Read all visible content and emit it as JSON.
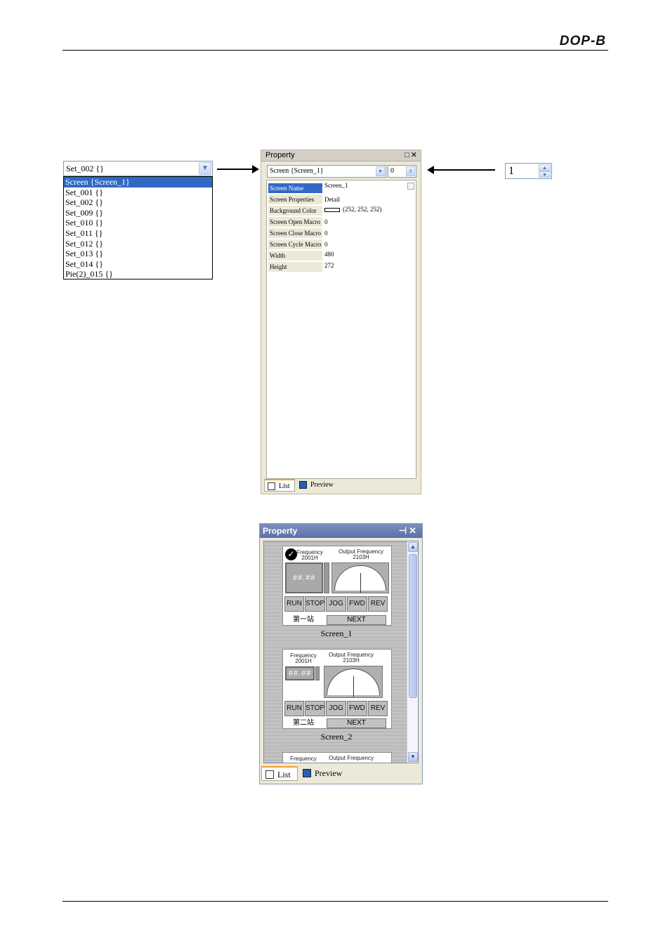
{
  "page": {
    "logo": "DOP-B"
  },
  "combo": {
    "value": "Set_002 {}",
    "options": [
      "Screen {Screen_1}",
      "Set_001 {}",
      "Set_002 {}",
      "Set_009 {}",
      "Set_010 {}",
      "Set_011 {}",
      "Set_012 {}",
      "Set_013 {}",
      "Set_014 {}",
      "Pie(2)_015 {}"
    ],
    "selected_index": 0
  },
  "spin": {
    "value": "1"
  },
  "panel1": {
    "title": "Property",
    "screen_select": "Screen {Screen_1}",
    "number": "0",
    "props": [
      {
        "key": "Screen Name",
        "value": "Screen_1"
      },
      {
        "key": "Screen Properties",
        "value": "Detail"
      },
      {
        "key": "Background Color",
        "value": "(252, 252, 252)"
      },
      {
        "key": "Screen Open Macro",
        "value": "0"
      },
      {
        "key": "Screen Close Macro",
        "value": "0"
      },
      {
        "key": "Screen Cycle Macro",
        "value": "0"
      },
      {
        "key": "Width",
        "value": "480"
      },
      {
        "key": "Height",
        "value": "272"
      }
    ],
    "tabs": [
      "List",
      "Preview"
    ]
  },
  "panel2": {
    "title": "Property",
    "thumbs": [
      {
        "freq_label": "Frequency",
        "freq_sub": "2001H",
        "out_label": "Output Frequency",
        "out_sub": "2103H",
        "display": "##.##",
        "buttons": [
          "RUN",
          "STOP",
          "JOG",
          "FWD",
          "REV"
        ],
        "cjk": "第一站",
        "next": "NEXT",
        "caption": "Screen_1"
      },
      {
        "freq_label": "Frequency",
        "freq_sub": "2001H",
        "out_label": "Output Frequency",
        "out_sub": "2103H",
        "display": "##.##",
        "buttons": [
          "RUN",
          "STOP",
          "JOG",
          "FWD",
          "REV"
        ],
        "cjk": "第二站",
        "next": "NEXT",
        "caption": "Screen_2"
      },
      {
        "freq_label": "Frequency",
        "out_label": "Output Frequency"
      }
    ],
    "tabs": [
      "List",
      "Preview"
    ]
  },
  "colors": {
    "selection": "#316ac5",
    "panel_bg": "#ece9d8",
    "title_blue": "#6b7fb3"
  }
}
